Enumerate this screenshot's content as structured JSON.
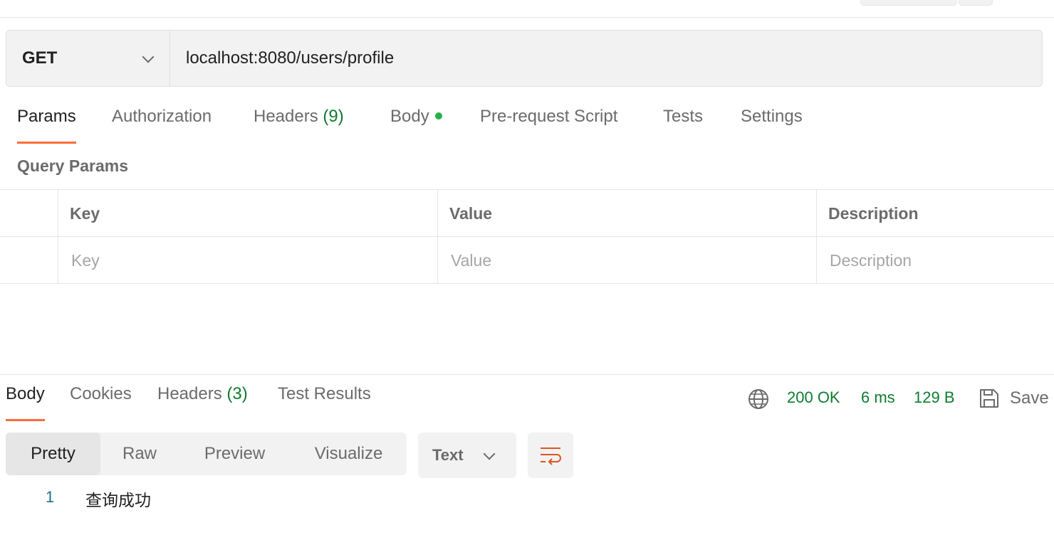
{
  "request": {
    "method": "GET",
    "url": "localhost:8080/users/profile"
  },
  "request_tabs": {
    "params": "Params",
    "authorization": "Authorization",
    "headers_label": "Headers",
    "headers_count": "(9)",
    "body": "Body",
    "prerequest": "Pre-request Script",
    "tests": "Tests",
    "settings": "Settings"
  },
  "query_params": {
    "title": "Query Params",
    "columns": [
      "Key",
      "Value",
      "Description"
    ],
    "placeholders": [
      "Key",
      "Value",
      "Description"
    ]
  },
  "response_tabs": {
    "body": "Body",
    "cookies": "Cookies",
    "headers_label": "Headers",
    "headers_count": "(3)",
    "test_results": "Test Results"
  },
  "response_status": {
    "status": "200 OK",
    "time": "6 ms",
    "size": "129 B",
    "save": "Save"
  },
  "view_modes": {
    "pretty": "Pretty",
    "raw": "Raw",
    "preview": "Preview",
    "visualize": "Visualize"
  },
  "format": {
    "selected": "Text"
  },
  "response_body": {
    "lines": [
      {
        "number": "1",
        "text": "查询成功"
      }
    ]
  },
  "colors": {
    "accent": "#ff6c37",
    "success": "#0f7b2f",
    "dot": "#26b047"
  }
}
